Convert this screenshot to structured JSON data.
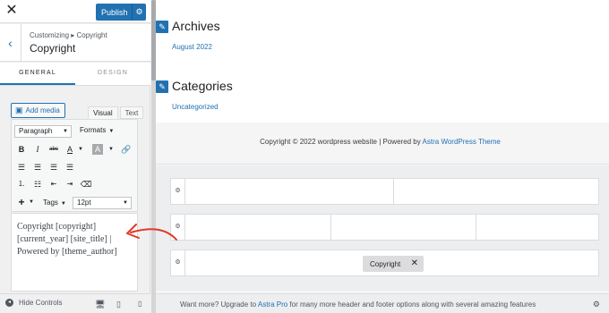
{
  "topbar": {
    "publish_label": "Publish"
  },
  "section": {
    "breadcrumb": "Customizing ▸ Copyright",
    "title": "Copyright"
  },
  "tabs": [
    {
      "label": "GENERAL",
      "active": true
    },
    {
      "label": "DESIGN",
      "active": false
    }
  ],
  "editor": {
    "add_media_label": "Add media",
    "mode_tabs": [
      {
        "label": "Visual",
        "active": true
      },
      {
        "label": "Text",
        "active": false
      }
    ],
    "paragraph_select": "Paragraph",
    "formats_label": "Formats",
    "tags_label": "Tags",
    "font_size_select": "12pt",
    "content_lines": [
      "Copyright [copyright]",
      "[current_year] [site_title] |",
      "Powered by [theme_author]"
    ]
  },
  "bottom": {
    "hide_controls_label": "Hide Controls"
  },
  "preview": {
    "archives_title": "Archives",
    "archives_link": "August 2022",
    "categories_title": "Categories",
    "categories_link": "Uncategorized",
    "footer_text": "Copyright © 2022 wordpress website | Powered by ",
    "footer_link": "Astra WordPress Theme"
  },
  "builder": {
    "copyright_chip": "Copyright",
    "upgrade_prefix": "Want more? Upgrade to ",
    "upgrade_link": "Astra Pro",
    "upgrade_suffix": " for many more header and footer options along with several amazing features"
  },
  "colors": {
    "accent": "#2271b1",
    "annotation_arrow": "#e2382b"
  },
  "icons": {
    "close": "close-icon",
    "gear": "gear-icon",
    "back": "chevron-left-icon",
    "pencil": "pencil-icon",
    "desktop": "desktop-icon",
    "tablet": "tablet-icon",
    "mobile": "mobile-icon"
  }
}
